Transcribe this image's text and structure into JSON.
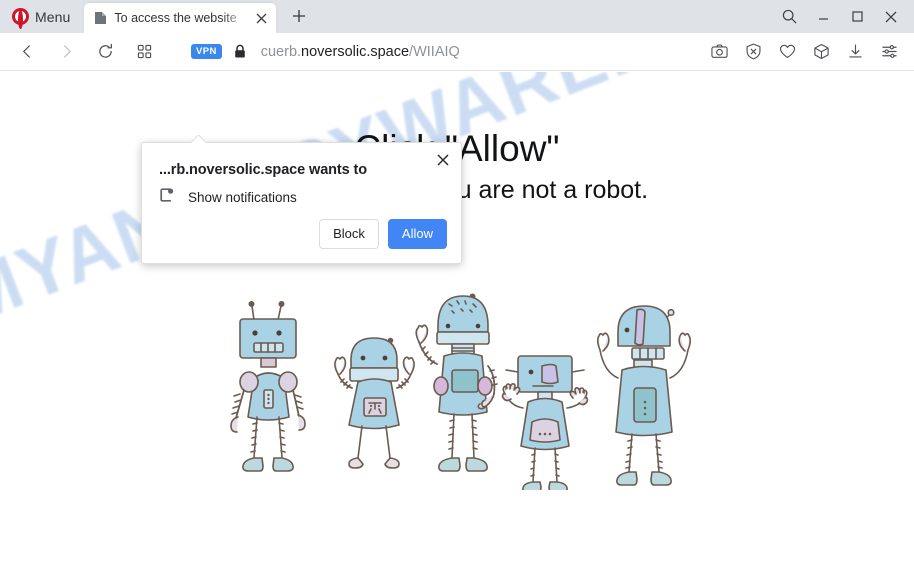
{
  "browser": {
    "menu_label": "Menu",
    "opera_logo_icon": "opera-logo-icon",
    "tab": {
      "title": "To access the website",
      "favicon": "page-icon",
      "close_icon": "close-icon"
    },
    "new_tab_label": "+",
    "window_controls": {
      "search": "search-icon",
      "minimize": "minimize-icon",
      "maximize": "maximize-icon",
      "close": "close-icon",
      "minimize_glyph": "—",
      "close_glyph": "✕"
    },
    "navigation": {
      "back_icon": "back-arrow-icon",
      "forward_icon": "forward-arrow-icon",
      "reload_icon": "reload-icon",
      "tiles_icon": "speed-dial-icon"
    },
    "address": {
      "vpn_badge": "VPN",
      "lock_icon": "padlock-icon",
      "url_prefix": "cuerb.",
      "url_domain": "noversolic.space",
      "url_path": "/WIIAIQ",
      "full_url": "cuerb.noversolic.space/WIIAIQ"
    },
    "toolbar_icons": [
      {
        "name": "snapshot-icon"
      },
      {
        "name": "adblock-shield-icon"
      },
      {
        "name": "heart-icon"
      },
      {
        "name": "workspaces-cube-icon"
      },
      {
        "name": "downloads-icon"
      },
      {
        "name": "easy-setup-icon"
      }
    ]
  },
  "permission_popup": {
    "origin_text": "...rb.noversolic.space wants to",
    "permission_icon": "notifications-icon",
    "permission_label": "Show notifications",
    "block_label": "Block",
    "allow_label": "Allow",
    "close_icon": "close-icon",
    "allow_color": "#4285f4"
  },
  "page": {
    "headline": "Click \"Allow\"",
    "subline": "to confirm that you are not a robot.",
    "watermark": "MYANTISPYWARE.COM",
    "watermark_color": "#c3d7f2",
    "illustration": "robots-illustration",
    "robot_count": 5
  }
}
